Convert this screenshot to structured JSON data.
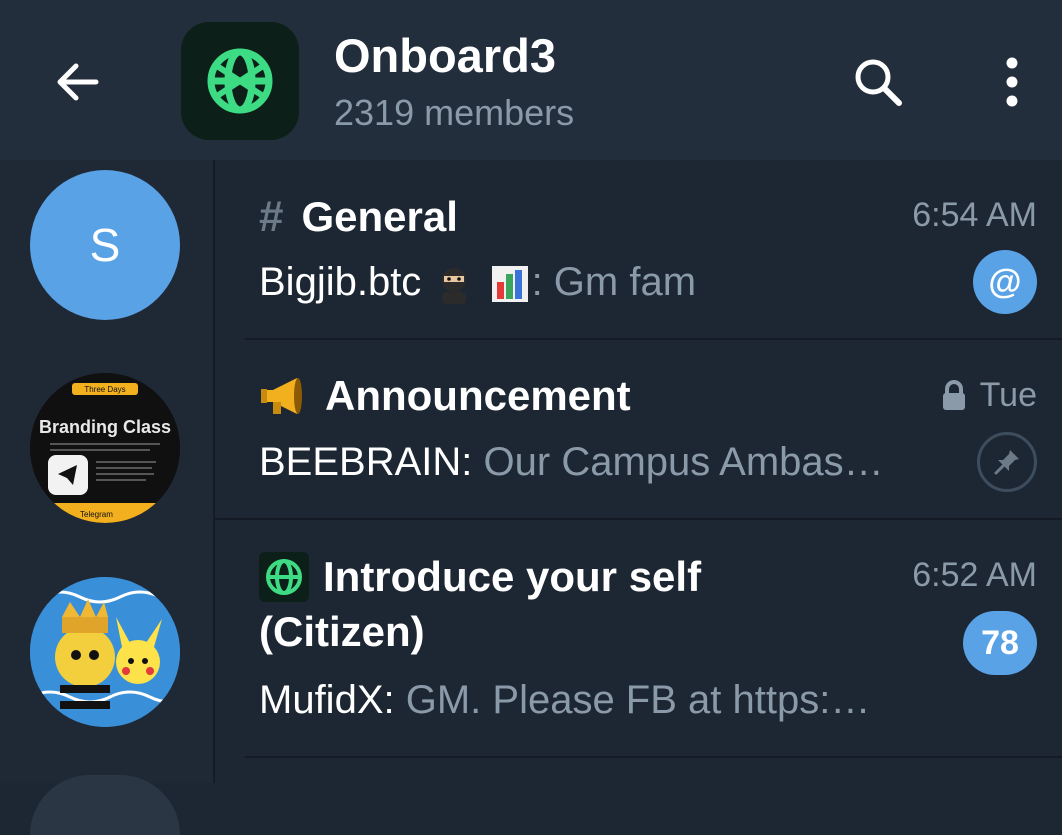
{
  "header": {
    "title": "Onboard3",
    "subtitle": "2319 members",
    "back_icon": "arrow-left-icon",
    "search_icon": "search-icon",
    "more_icon": "more-vertical-icon",
    "accent": "#5aa2e6",
    "avatar_color": "#3ddc84"
  },
  "sidebar": {
    "items": [
      {
        "label": "S",
        "color": "#5aa2e6"
      },
      {
        "type": "branding-class-image",
        "text_top": "Three Days",
        "text_main": "Branding Class",
        "text_bottom": "Telegram"
      },
      {
        "type": "bee-pikachu-image"
      }
    ]
  },
  "topics": [
    {
      "title": "General",
      "time": "6:54 AM",
      "sender": "Bigjib.btc",
      "message": ": Gm fam",
      "badge": "@",
      "icon": "hash-icon"
    },
    {
      "title": "Announcement",
      "time": "Tue",
      "sender": "BEEBRAIN:",
      "message": " Our Campus Ambas…",
      "icon": "megaphone-icon",
      "locked": true,
      "pinned": true
    },
    {
      "title": "Introduce your self",
      "title_line2": "(Citizen)",
      "time": "6:52 AM",
      "sender": "MufidX:",
      "message": " GM. Please FB at https:…",
      "badge": "78",
      "icon": "onboard3-logo-icon"
    }
  ]
}
